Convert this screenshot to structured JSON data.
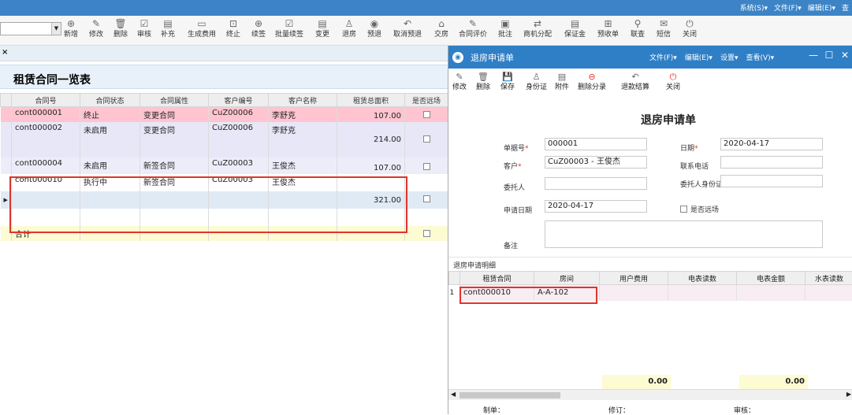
{
  "topmenu": [
    "系统(S)▾",
    "文件(F)▾",
    "编辑(E)▾",
    "查"
  ],
  "toolbar": [
    {
      "label": "新增",
      "icon": "add-icon",
      "glyph": "⊕"
    },
    {
      "label": "修改",
      "icon": "edit-icon",
      "glyph": "✎"
    },
    {
      "label": "删除",
      "icon": "trash-icon",
      "glyph": "🗑"
    },
    {
      "label": "审核",
      "icon": "check-icon",
      "glyph": "☑"
    },
    {
      "label": "补充",
      "icon": "doc-icon",
      "glyph": "▤"
    },
    {
      "label": "生成费用",
      "icon": "fee-icon",
      "glyph": "▭"
    },
    {
      "label": "终止",
      "icon": "stop-icon",
      "glyph": "⊡"
    },
    {
      "label": "续签",
      "icon": "plus-circle-icon",
      "glyph": "⊕"
    },
    {
      "label": "批量续签",
      "icon": "batch-icon",
      "glyph": "☑"
    },
    {
      "label": "变更",
      "icon": "change-icon",
      "glyph": "▤"
    },
    {
      "label": "退房",
      "icon": "person-icon",
      "glyph": "♙"
    },
    {
      "label": "预退",
      "icon": "eye-icon",
      "glyph": "◉"
    },
    {
      "label": "取消预退",
      "icon": "undo-icon",
      "glyph": "↶"
    },
    {
      "label": "交房",
      "icon": "home-icon",
      "glyph": "⌂"
    },
    {
      "label": "合同评价",
      "icon": "pen-icon",
      "glyph": "✎"
    },
    {
      "label": "批注",
      "icon": "note-icon",
      "glyph": "▣"
    },
    {
      "label": "商机分配",
      "icon": "swap-icon",
      "glyph": "⇄"
    },
    {
      "label": "保证金",
      "icon": "deposit-icon",
      "glyph": "▤"
    },
    {
      "label": "预收单",
      "icon": "receipt-icon",
      "glyph": "⊞"
    },
    {
      "label": "联查",
      "icon": "search-icon",
      "glyph": "⚲"
    },
    {
      "label": "短信",
      "icon": "mail-icon",
      "glyph": "✉"
    },
    {
      "label": "关闭",
      "icon": "power-icon",
      "glyph": "⏻"
    }
  ],
  "list": {
    "title": "租赁合同一览表",
    "columns": [
      "合同号",
      "合同状态",
      "合同属性",
      "客户编号",
      "客户名称",
      "租赁总面积",
      "是否远场"
    ],
    "rows": [
      {
        "contract": "cont000001",
        "status": "终止",
        "attr": "变更合同",
        "custno": "CuZ00006",
        "custname": "李舒克",
        "area": "107.00"
      },
      {
        "contract": "cont000002",
        "status": "未启用",
        "attr": "变更合同",
        "custno": "CuZ00006",
        "custname": "李舒克",
        "area": "214.00"
      },
      {
        "contract": "cont000004",
        "status": "未启用",
        "attr": "新签合同",
        "custno": "CuZ00003",
        "custname": "王俊杰",
        "area": "107.00"
      },
      {
        "contract": "cont000010",
        "status": "执行中",
        "attr": "新签合同",
        "custno": "CuZ00003",
        "custname": "王俊杰",
        "area": ""
      },
      {
        "contract": "",
        "status": "",
        "attr": "",
        "custno": "",
        "custname": "",
        "area": "321.00"
      }
    ],
    "total_label": "合计"
  },
  "dialog": {
    "title": "退房申请单",
    "menu": [
      "文件(F)▾",
      "编辑(E)▾",
      "设置▾",
      "查看(V)▾"
    ],
    "tools": [
      {
        "label": "修改",
        "icon": "edit-icon",
        "glyph": "✎"
      },
      {
        "label": "删除",
        "icon": "trash-icon",
        "glyph": "🗑"
      },
      {
        "label": "保存",
        "icon": "save-icon",
        "glyph": "💾"
      },
      {
        "label": "身份证",
        "icon": "id-icon",
        "glyph": "♙"
      },
      {
        "label": "附件",
        "icon": "attach-icon",
        "glyph": "▤"
      },
      {
        "label": "删除分录",
        "icon": "minus-circle-icon",
        "glyph": "⊖"
      },
      {
        "label": "退款结算",
        "icon": "refund-icon",
        "glyph": "↶"
      },
      {
        "label": "关闭",
        "icon": "power-icon",
        "glyph": "⏻"
      }
    ],
    "form_title": "退房申请单",
    "fields": {
      "docno_label": "单据号",
      "docno": "000001",
      "date_label": "日期",
      "date": "2020-04-17",
      "customer_label": "客户",
      "customer": "CuZ00003 - 王俊杰",
      "phone_label": "联系电话",
      "phone": "",
      "agent_label": "委托人",
      "agent": "",
      "agent_id_label": "委托人身份证",
      "agent_id": "",
      "apply_date_label": "申请日期",
      "apply_date": "2020-04-17",
      "remote_label": "是否远场",
      "remark_label": "备注",
      "remark": ""
    },
    "detail_label": "退房申请明细",
    "detail_columns": [
      "租赁合同",
      "房间",
      "用户费用",
      "电表读数",
      "电表金额",
      "水表读数"
    ],
    "detail_rows": [
      {
        "no": "1",
        "contract": "cont000010",
        "room": "A-A-102"
      }
    ],
    "totals": [
      "0.00",
      "0.00"
    ],
    "footer": {
      "maker": "制单：",
      "revise": "修订：",
      "audit": "审核："
    }
  }
}
